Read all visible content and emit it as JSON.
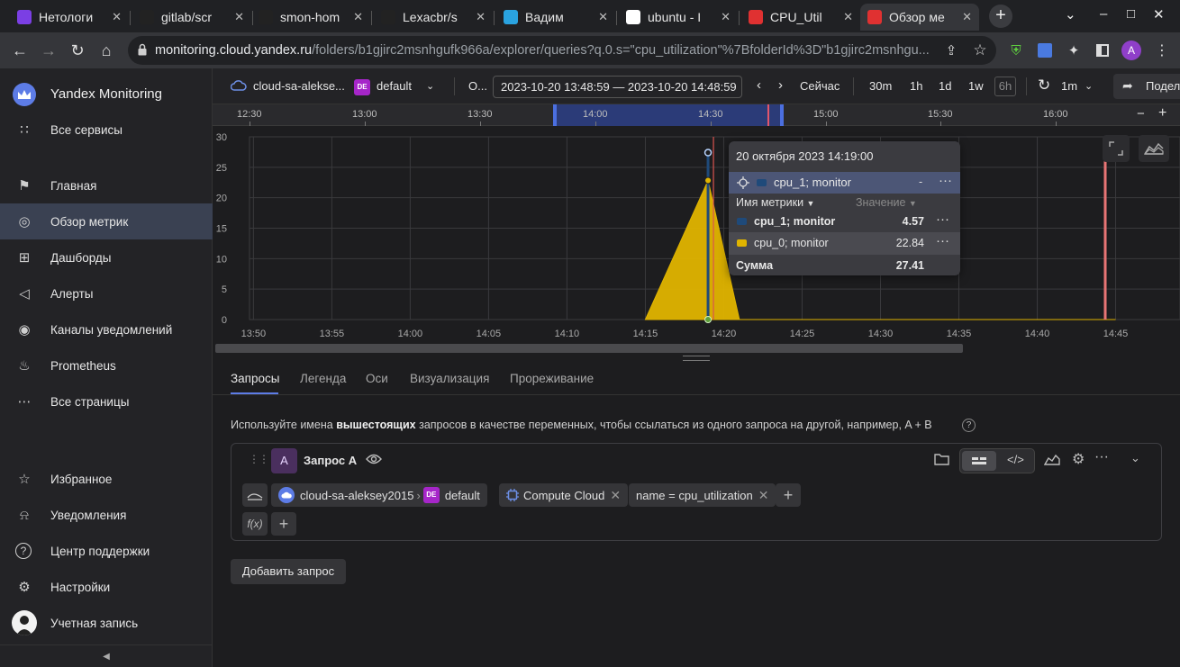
{
  "browser": {
    "tabs": [
      {
        "title": "Нетологи",
        "icon": "netology-icon",
        "color": "#7b3fe4"
      },
      {
        "title": "gitlab/scr",
        "icon": "github-icon",
        "color": "#222"
      },
      {
        "title": "smon-hom",
        "icon": "github-icon",
        "color": "#222"
      },
      {
        "title": "Lexacbr/s",
        "icon": "github-icon",
        "color": "#222"
      },
      {
        "title": "Вадим",
        "icon": "telegram-icon",
        "color": "#2aa3e0"
      },
      {
        "title": "ubuntu - I",
        "icon": "google-icon",
        "color": "#fff"
      },
      {
        "title": "CPU_Util",
        "icon": "monitoring-icon",
        "color": "#e03131"
      },
      {
        "title": "Обзор ме",
        "icon": "monitoring-icon",
        "color": "#e03131"
      }
    ],
    "url_host": "monitoring.cloud.yandex.ru",
    "url_path": "/folders/b1gjirc2msnhgufk966a/explorer/queries?q.0.s=\"cpu_utilization\"%7BfolderId%3D\"b1gjirc2msnhgu...",
    "avatar_letter": "A"
  },
  "sidebar": {
    "brand": "Yandex Monitoring",
    "items": [
      {
        "label": "Все сервисы",
        "icon": "grid-icon"
      },
      {
        "label": "Главная",
        "icon": "flag-icon"
      },
      {
        "label": "Обзор метрик",
        "icon": "compass-icon"
      },
      {
        "label": "Дашборды",
        "icon": "dashboard-icon"
      },
      {
        "label": "Алерты",
        "icon": "megaphone-icon"
      },
      {
        "label": "Каналы уведомлений",
        "icon": "broadcast-icon"
      },
      {
        "label": "Prometheus",
        "icon": "flame-icon"
      },
      {
        "label": "Все страницы",
        "icon": "dots-icon"
      }
    ],
    "bottom": [
      {
        "label": "Избранное",
        "icon": "star-icon"
      },
      {
        "label": "Уведомления",
        "icon": "bell-icon"
      },
      {
        "label": "Центр поддержки",
        "icon": "help-icon"
      },
      {
        "label": "Настройки",
        "icon": "gear-icon"
      },
      {
        "label": "Учетная запись",
        "icon": "avatar-icon"
      }
    ]
  },
  "header": {
    "cloud": "cloud-sa-alekse...",
    "de": "DE",
    "folder": "default",
    "o_label": "О...",
    "range": "2023-10-20 13:48:59 — 2023-10-20 14:48:59",
    "now": "Сейчас",
    "presets": [
      "30m",
      "1h",
      "1d",
      "1w",
      "6h"
    ],
    "refresh": "1m",
    "share": "Подел"
  },
  "timeline": {
    "ticks": [
      "12:30",
      "13:00",
      "13:30",
      "14:00",
      "14:30",
      "15:00",
      "15:30",
      "16:00"
    ]
  },
  "chart_data": {
    "type": "area",
    "x": [
      "13:50",
      "13:55",
      "14:00",
      "14:05",
      "14:10",
      "14:15",
      "14:20",
      "14:25",
      "14:30",
      "14:35",
      "14:40",
      "14:45"
    ],
    "ylim": [
      0,
      30
    ],
    "yticks": [
      0,
      5,
      10,
      15,
      20,
      25,
      30
    ],
    "series": [
      {
        "name": "cpu_0; monitor",
        "color": "#e0b400",
        "points": [
          [
            14.25,
            0
          ],
          [
            14.3167,
            22.84
          ],
          [
            14.35,
            0
          ],
          [
            14.75,
            0
          ]
        ]
      },
      {
        "name": "cpu_1; monitor",
        "color": "#1f4a7a",
        "points": [
          [
            14.3167,
            4.57
          ]
        ]
      }
    ],
    "cursor": "14:19",
    "stacked_point": 27.41
  },
  "tooltip": {
    "date": "20 октября 2023 14:19:00",
    "pinned": "cpu_1; monitor",
    "pinned_value": "-",
    "col_name": "Имя метрики",
    "col_value": "Значение",
    "rows": [
      {
        "name": "cpu_1; monitor",
        "value": "4.57",
        "color": "#1f4a7a"
      },
      {
        "name": "cpu_0; monitor",
        "value": "22.84",
        "color": "#e0b400"
      }
    ],
    "sum_label": "Сумма",
    "sum_value": "27.41"
  },
  "panel": {
    "tabs": [
      "Запросы",
      "Легенда",
      "Оси",
      "Визуализация",
      "Прореживание"
    ],
    "hint_pre": "Используйте имена ",
    "hint_bold": "вышестоящих",
    "hint_post": " запросов в качестве переменных, чтобы ссылаться из одного запроса на другой, например, A + B",
    "query": {
      "letter": "A",
      "title": "Запрос А",
      "cloud": "cloud-sa-aleksey2015",
      "folder": "default",
      "service": "Compute Cloud",
      "filter": "name = cpu_utilization",
      "fx": "f(x)"
    },
    "add_query": "Добавить запрос"
  }
}
